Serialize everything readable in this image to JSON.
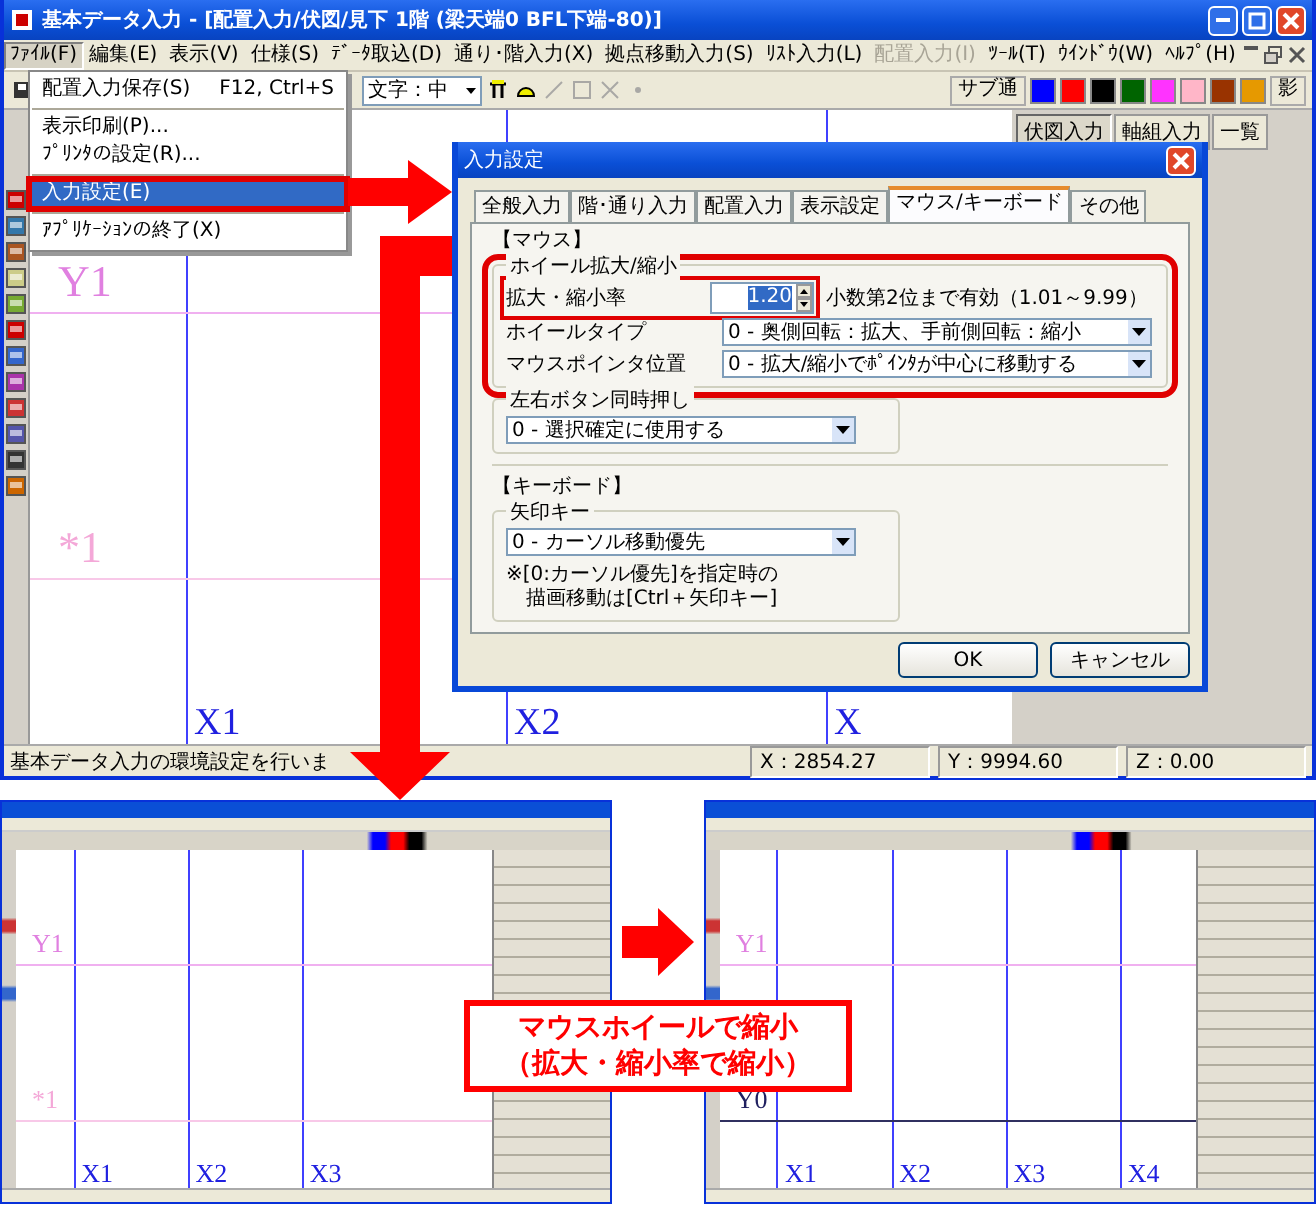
{
  "window": {
    "title": "基本データ入力 - [配置入力/伏図/見下 1階 (梁天端0 BFL下端-80)]"
  },
  "menu_bar": [
    {
      "label": "ﾌｧｲﾙ(F)",
      "selected": true,
      "disabled": false
    },
    {
      "label": "編集(E)",
      "selected": false,
      "disabled": false
    },
    {
      "label": "表示(V)",
      "selected": false,
      "disabled": false
    },
    {
      "label": "仕様(S)",
      "selected": false,
      "disabled": false
    },
    {
      "label": "ﾃﾞｰﾀ取込(D)",
      "selected": false,
      "disabled": false
    },
    {
      "label": "通り･階入力(X)",
      "selected": false,
      "disabled": false
    },
    {
      "label": "拠点移動入力(S)",
      "selected": false,
      "disabled": false
    },
    {
      "label": "ﾘｽﾄ入力(L)",
      "selected": false,
      "disabled": false
    },
    {
      "label": "配置入力(I)",
      "selected": false,
      "disabled": true
    },
    {
      "label": "ﾂｰﾙ(T)",
      "selected": false,
      "disabled": false
    },
    {
      "label": "ｳｲﾝﾄﾞｳ(W)",
      "selected": false,
      "disabled": false
    },
    {
      "label": "ﾍﾙﾌﾟ(H)",
      "selected": false,
      "disabled": false
    }
  ],
  "file_menu": {
    "items": [
      {
        "kind": "item",
        "label": "配置入力保存(S)",
        "shortcut": "F12, Ctrl+S",
        "selected": false,
        "highlighted": false
      },
      {
        "kind": "separator"
      },
      {
        "kind": "item",
        "label": "表示印刷(P)...",
        "selected": false,
        "highlighted": false
      },
      {
        "kind": "item",
        "label": "ﾌﾟﾘﾝﾀの設定(R)...",
        "selected": false,
        "highlighted": false
      },
      {
        "kind": "separator"
      },
      {
        "kind": "item",
        "label": "入力設定(E)",
        "selected": true,
        "highlighted": true
      },
      {
        "kind": "separator"
      },
      {
        "kind": "item",
        "label": "ｱﾌﾟﾘｹｰｼｮﾝの終了(X)",
        "selected": false,
        "highlighted": false
      }
    ]
  },
  "toolbar": {
    "font_select": "文字：中",
    "sub_button": "サブ通",
    "shadow_button": "影",
    "swatches": [
      {
        "color": "#0000ff"
      },
      {
        "color": "#ff0000"
      },
      {
        "color": "#000000"
      },
      {
        "color": "#006400"
      },
      {
        "color": "#ff33ff"
      },
      {
        "color": "#ffb6c8"
      },
      {
        "color": "#993300"
      },
      {
        "color": "#e69900"
      }
    ]
  },
  "side_tabs": [
    {
      "label": "伏図入力",
      "selected": true
    },
    {
      "label": "軸組入力",
      "selected": false
    },
    {
      "label": "一覧",
      "selected": false
    }
  ],
  "canvas": {
    "y_labels": [
      {
        "text": "Y1",
        "kind": "main"
      },
      {
        "text": "*1",
        "kind": "sub"
      }
    ],
    "x_labels": [
      "X1",
      "X2",
      "X"
    ]
  },
  "status_bar": {
    "message": "基本データ入力の環境設定を行いま",
    "x": "X：2854.27",
    "y": "Y：9994.60",
    "z": "Z：0.00"
  },
  "dialog": {
    "title": "入力設定",
    "tabs": [
      {
        "label": "全般入力",
        "selected": false
      },
      {
        "label": "階･通り入力",
        "selected": false
      },
      {
        "label": "配置入力",
        "selected": false
      },
      {
        "label": "表示設定",
        "selected": false
      },
      {
        "label": "マウス/キーボード",
        "selected": true
      },
      {
        "label": "その他",
        "selected": false
      }
    ],
    "mouse_heading": "【マウス】",
    "wheel_group": {
      "title": "ホイール拡大/縮小",
      "highlighted": true,
      "rate": {
        "label": "拡大・縮小率",
        "value": "1.20",
        "value_selected": true,
        "hint": "小数第2位まで有効（1.01～9.99）",
        "highlighted": true
      },
      "selects": [
        {
          "label": "ホイールタイプ",
          "value": "0 - 奥側回転：拡大、手前側回転：縮小"
        },
        {
          "label": "マウスポインタ位置",
          "value": "0 - 拡大/縮小でﾎﾟｲﾝﾀが中心に移動する"
        }
      ]
    },
    "both_buttons_group": {
      "title": "左右ボタン同時押し",
      "value": "0 - 選択確定に使用する"
    },
    "keyboard_heading": "【キーボード】",
    "arrow_key_group": {
      "title": "矢印キー",
      "value": "0 - カーソル移動優先",
      "note_lines": [
        "※[0:カーソル優先]を指定時の",
        "　描画移動は[Ctrl＋矢印キー]"
      ]
    },
    "buttons": [
      "OK",
      "キャンセル"
    ]
  },
  "thumbnails": [
    {
      "y_labels": [
        {
          "text": "Y1",
          "kind": "main"
        },
        {
          "text": "*1",
          "kind": "sub"
        }
      ],
      "x_labels": [
        "X1",
        "X2",
        "X3"
      ]
    },
    {
      "y_labels": [
        {
          "text": "Y1",
          "kind": "main"
        },
        {
          "text": "Y0",
          "kind": "base"
        }
      ],
      "x_labels": [
        "X1",
        "X2",
        "X3",
        "X4"
      ]
    }
  ],
  "callout": {
    "lines": [
      "マウスホイールで縮小",
      "（拡大・縮小率で縮小）"
    ]
  }
}
